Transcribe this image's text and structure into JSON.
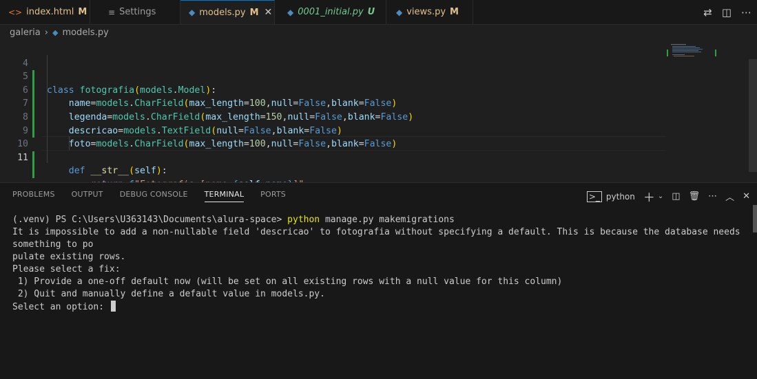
{
  "tabs": [
    {
      "icon": "<>",
      "label": "index.html",
      "badge": "M",
      "color": "#e37933"
    },
    {
      "icon": "≡",
      "label": "Settings",
      "badge": "",
      "color": "#cccccc"
    },
    {
      "icon": "py",
      "label": "models.py",
      "badge": "M",
      "color": "#e2c08d",
      "active": true
    },
    {
      "icon": "py",
      "label": "0001_initial.py",
      "badge": "U",
      "color": "#73c991"
    },
    {
      "icon": "py",
      "label": "views.py",
      "badge": "M",
      "color": "#e2c08d"
    }
  ],
  "breadcrumb": {
    "folder": "galeria",
    "file": "models.py"
  },
  "editor": {
    "lines": [
      {
        "num": "4"
      },
      {
        "num": "5"
      },
      {
        "num": "6"
      },
      {
        "num": "7"
      },
      {
        "num": "8"
      },
      {
        "num": "9"
      },
      {
        "num": "10"
      },
      {
        "num": "11"
      }
    ],
    "current_line": "11"
  },
  "panel": {
    "tabs": [
      "PROBLEMS",
      "OUTPUT",
      "DEBUG CONSOLE",
      "TERMINAL",
      "PORTS"
    ],
    "active_tab": "TERMINAL",
    "terminal_name": "python"
  },
  "terminal": {
    "prompt": "(.venv) PS C:\\Users\\U363143\\Documents\\alura-space> ",
    "command_name": "python",
    "command_args": " manage.py makemigrations",
    "output": [
      "It is impossible to add a non-nullable field 'descricao' to fotografia without specifying a default. This is because the database needs something to po",
      "pulate existing rows.",
      "Please select a fix:",
      " 1) Provide a one-off default now (will be set on all existing rows with a null value for this column)",
      " 2) Quit and manually define a default value in models.py."
    ],
    "input_prompt": "Select an option: "
  },
  "colors": {
    "accent": "#0078d4",
    "git_added": "#2ea043"
  }
}
